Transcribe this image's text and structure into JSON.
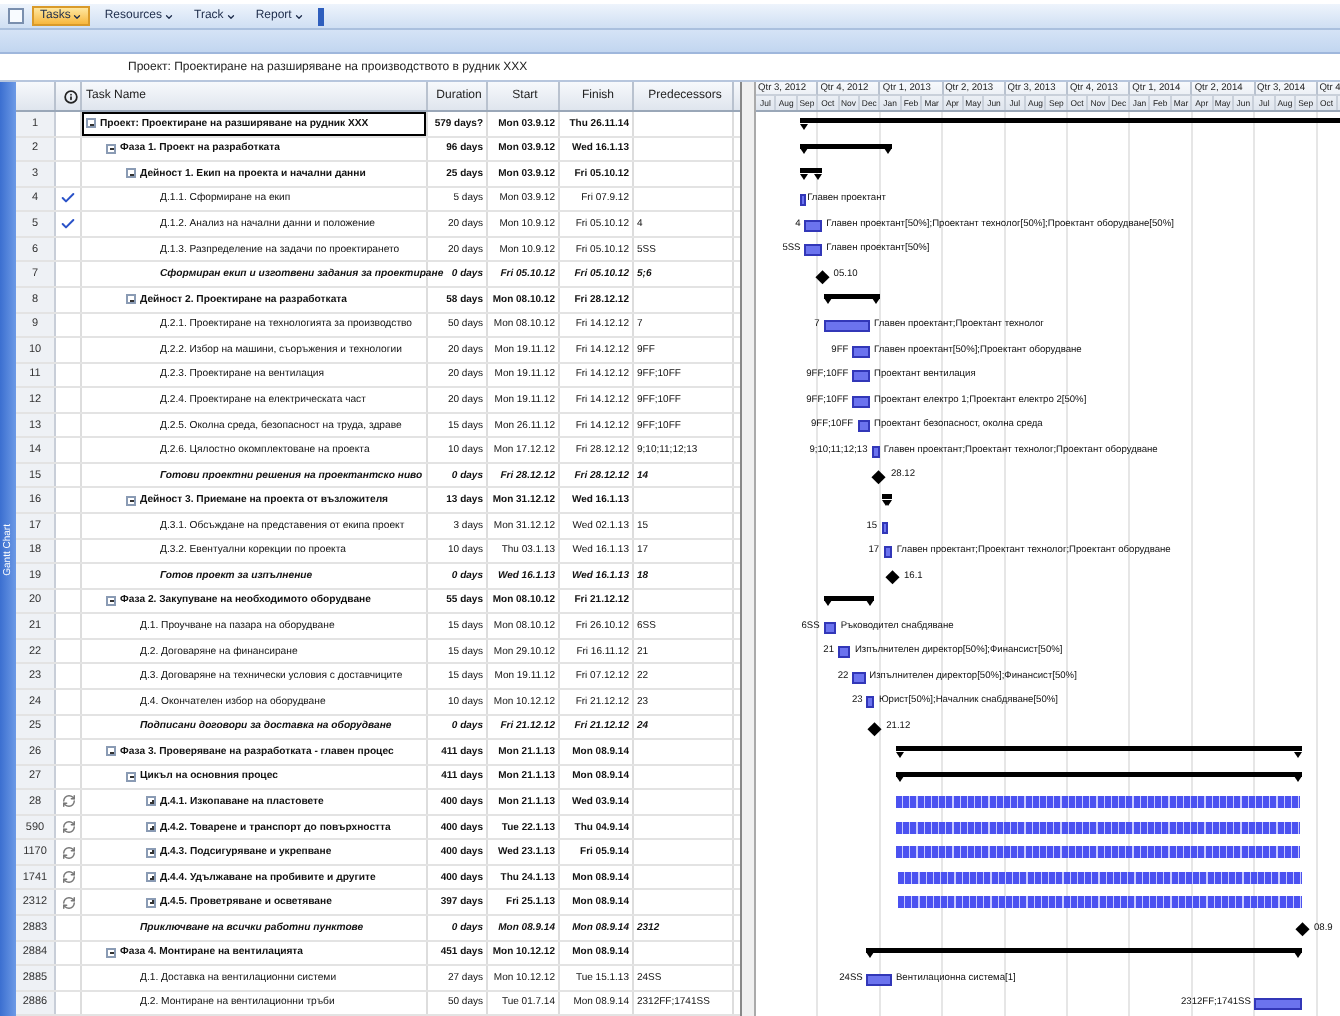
{
  "toolbar": {
    "items": [
      {
        "label": "Tasks",
        "selected": true
      },
      {
        "label": "Resources",
        "selected": false
      },
      {
        "label": "Track",
        "selected": false
      },
      {
        "label": "Report",
        "selected": false
      }
    ]
  },
  "project_title": "Проект: Проектиране на разширяване на производството в рудник XXX",
  "view_bar": "Gantt Chart",
  "columns": [
    "Task Name",
    "Duration",
    "Start",
    "Finish",
    "Predecessors"
  ],
  "timescale": {
    "quarters": [
      "Qtr 3, 2012",
      "Qtr 4, 2012",
      "Qtr 1, 2013",
      "Qtr 2, 2013",
      "Qtr 3, 2013",
      "Qtr 4, 2013",
      "Qtr 1, 2014",
      "Qtr 2, 2014",
      "Qtr 3, 2014",
      "Qtr 4"
    ],
    "months": [
      "Jul",
      "Aug",
      "Sep",
      "Oct",
      "Nov",
      "Dec",
      "Jan",
      "Feb",
      "Mar",
      "Apr",
      "May",
      "Jun",
      "Jul",
      "Aug",
      "Sep",
      "Oct",
      "Nov",
      "Dec",
      "Jan",
      "Feb",
      "Mar",
      "Apr",
      "May",
      "Jun",
      "Jul",
      "Aug",
      "Sep",
      "Oct"
    ]
  },
  "tasks": [
    {
      "id": "1",
      "kind": "summary",
      "name": "Проект: Проектиране на разширяване на рудник XXX",
      "duration": "579 days?",
      "start": "Mon 03.9.12",
      "finish": "Thu 26.11.14",
      "selected": true,
      "expanded": true,
      "children": [
        {
          "id": "2",
          "kind": "summary",
          "name": "Фаза 1. Проект на разработката",
          "duration": "96 days",
          "start": "Mon 03.9.12",
          "finish": "Wed 16.1.13",
          "selected": false,
          "expanded": true,
          "children": [
            {
              "id": "3",
              "kind": "summary",
              "name": "Дейност 1. Екип на проекта и начални данни",
              "duration": "25 days",
              "start": "Mon 03.9.12",
              "finish": "Fri 05.10.12",
              "selected": false,
              "expanded": true,
              "children": [
                {
                  "id": "4",
                  "kind": "task",
                  "complete": true,
                  "name": "Д.1.1. Сформиране на екип",
                  "duration": "5 days",
                  "start": "Mon 03.9.12",
                  "finish": "Fri 07.9.12",
                  "selected": false,
                  "bar_label": "Главен проектант"
                },
                {
                  "id": "5",
                  "kind": "task",
                  "complete": true,
                  "name": "Д.1.2. Анализ на начални данни и положение",
                  "duration": "20 days",
                  "start": "Mon 10.9.12",
                  "finish": "Fri 05.10.12",
                  "predecessors": "4",
                  "selected": false,
                  "bar_left_label": "4",
                  "bar_label": "Главен проектант[50%];Проектант технолог[50%];Проектант оборудване[50%]"
                },
                {
                  "id": "6",
                  "kind": "task",
                  "name": "Д.1.3. Разпределение на задачи по проектирането",
                  "duration": "20 days",
                  "start": "Mon 10.9.12",
                  "finish": "Fri 05.10.12",
                  "predecessors": "5SS",
                  "selected": false,
                  "bar_left_label": "5SS",
                  "bar_label": "Главен проектант[50%]"
                },
                {
                  "id": "7",
                  "kind": "milestone",
                  "name": "Сформиран екип и изготвени задания за проектиране",
                  "duration": "0 days",
                  "start": "Fri 05.10.12",
                  "finish": "Fri 05.10.12",
                  "predecessors": "5;6",
                  "selected": false,
                  "bar_label": "05.10"
                }
              ]
            },
            {
              "id": "8",
              "kind": "summary",
              "name": "Дейност 2. Проектиране на разработката",
              "duration": "58 days",
              "start": "Mon 08.10.12",
              "finish": "Fri 28.12.12",
              "selected": false,
              "expanded": true,
              "children": [
                {
                  "id": "9",
                  "kind": "task",
                  "name": "Д.2.1. Проектиране на технологията за производство",
                  "duration": "50 days",
                  "start": "Mon 08.10.12",
                  "finish": "Fri 14.12.12",
                  "predecessors": "7",
                  "selected": false,
                  "bar_left_label": "7",
                  "bar_label": "Главен проектант;Проектант технолог"
                },
                {
                  "id": "10",
                  "kind": "task",
                  "name": "Д.2.2. Избор на машини, съоръжения и технологии",
                  "duration": "20 days",
                  "start": "Mon 19.11.12",
                  "finish": "Fri 14.12.12",
                  "predecessors": "9FF",
                  "selected": false,
                  "bar_left_label": "9FF",
                  "bar_label": "Главен проектант[50%];Проектант оборудване"
                },
                {
                  "id": "11",
                  "kind": "task",
                  "name": "Д.2.3. Проектиране на вентилация",
                  "duration": "20 days",
                  "start": "Mon 19.11.12",
                  "finish": "Fri 14.12.12",
                  "predecessors": "9FF;10FF",
                  "selected": false,
                  "bar_left_label": "9FF;10FF",
                  "bar_label": "Проектант вентилация"
                },
                {
                  "id": "12",
                  "kind": "task",
                  "name": "Д.2.4. Проектиране на електрическата част",
                  "duration": "20 days",
                  "start": "Mon 19.11.12",
                  "finish": "Fri 14.12.12",
                  "predecessors": "9FF;10FF",
                  "selected": false,
                  "bar_left_label": "9FF;10FF",
                  "bar_label": "Проектант електро 1;Проектант електро 2[50%]"
                },
                {
                  "id": "13",
                  "kind": "task",
                  "name": "Д.2.5. Околна среда, безопасност на труда, здраве",
                  "duration": "15 days",
                  "start": "Mon 26.11.12",
                  "finish": "Fri 14.12.12",
                  "predecessors": "9FF;10FF",
                  "selected": false,
                  "bar_left_label": "9FF;10FF",
                  "bar_label": "Проектант безопасност, околна среда"
                },
                {
                  "id": "14",
                  "kind": "task",
                  "name": "Д.2.6. Цялостно окомплектоване на проекта",
                  "duration": "10 days",
                  "start": "Mon 17.12.12",
                  "finish": "Fri 28.12.12",
                  "predecessors": "9;10;11;12;13",
                  "selected": false,
                  "bar_left_label": "9;10;11;12;13",
                  "bar_label": "Главен проектант;Проектант технолог;Проектант оборудване"
                },
                {
                  "id": "15",
                  "kind": "milestone",
                  "name": "Готови проектни решения на проектантско ниво",
                  "duration": "0 days",
                  "start": "Fri 28.12.12",
                  "finish": "Fri 28.12.12",
                  "predecessors": "14",
                  "selected": false,
                  "bar_label": "28.12"
                }
              ]
            },
            {
              "id": "16",
              "kind": "summary",
              "name": "Дейност 3. Приемане на проекта от възложителя",
              "duration": "13 days",
              "start": "Mon 31.12.12",
              "finish": "Wed 16.1.13",
              "selected": false,
              "expanded": true,
              "children": [
                {
                  "id": "17",
                  "kind": "task",
                  "name": "Д.3.1. Обсъждане на представения от екипа проект",
                  "duration": "3 days",
                  "start": "Mon 31.12.12",
                  "finish": "Wed 02.1.13",
                  "predecessors": "15",
                  "selected": false,
                  "bar_left_label": "15"
                },
                {
                  "id": "18",
                  "kind": "task",
                  "name": "Д.3.2. Евентуални корекции по проекта",
                  "duration": "10 days",
                  "start": "Thu 03.1.13",
                  "finish": "Wed 16.1.13",
                  "predecessors": "17",
                  "selected": false,
                  "bar_left_label": "17",
                  "bar_label": "Главен проектант;Проектант технолог;Проектант оборудване"
                },
                {
                  "id": "19",
                  "kind": "milestone",
                  "name": "Готов проект за изпълнение",
                  "duration": "0 days",
                  "start": "Wed 16.1.13",
                  "finish": "Wed 16.1.13",
                  "predecessors": "18",
                  "selected": false,
                  "bar_label": "16.1"
                }
              ]
            }
          ]
        },
        {
          "id": "20",
          "kind": "summary",
          "name": "Фаза 2. Закупуване на необходимото оборудване",
          "duration": "55 days",
          "start": "Mon 08.10.12",
          "finish": "Fri 21.12.12",
          "selected": false,
          "expanded": true,
          "children": [
            {
              "id": "21",
              "kind": "task",
              "name": "Д.1. Проучване на пазара на оборудване",
              "duration": "15 days",
              "start": "Mon 08.10.12",
              "finish": "Fri 26.10.12",
              "predecessors": "6SS",
              "selected": false,
              "bar_left_label": "6SS",
              "bar_label": "Ръководител снабдяване"
            },
            {
              "id": "22",
              "kind": "task",
              "name": "Д.2. Договаряне на финансиране",
              "duration": "15 days",
              "start": "Mon 29.10.12",
              "finish": "Fri 16.11.12",
              "predecessors": "21",
              "selected": false,
              "bar_left_label": "21",
              "bar_label": "Изпълнителен директор[50%];Финансист[50%]"
            },
            {
              "id": "23",
              "kind": "task",
              "name": "Д.3. Договаряне на технически условия с доставчиците",
              "duration": "15 days",
              "start": "Mon 19.11.12",
              "finish": "Fri 07.12.12",
              "predecessors": "22",
              "selected": false,
              "bar_left_label": "22",
              "bar_label": "Изпълнителен директор[50%];Финансист[50%]"
            },
            {
              "id": "24",
              "kind": "task",
              "name": "Д.4. Окончателен избор на оборудване",
              "duration": "10 days",
              "start": "Mon 10.12.12",
              "finish": "Fri 21.12.12",
              "predecessors": "23",
              "selected": false,
              "bar_left_label": "23",
              "bar_label": "Юрист[50%];Началник снабдяване[50%]"
            },
            {
              "id": "25",
              "kind": "milestone",
              "name": "Подписани договори за доставка на оборудване",
              "duration": "0 days",
              "start": "Fri 21.12.12",
              "finish": "Fri 21.12.12",
              "predecessors": "24",
              "selected": false,
              "bar_label": "21.12"
            }
          ]
        },
        {
          "id": "26",
          "kind": "summary",
          "name": "Фаза 3. Проверяване на разработката - главен процес",
          "duration": "411 days",
          "start": "Mon 21.1.13",
          "finish": "Mon 08.9.14",
          "selected": false,
          "expanded": true,
          "children": [
            {
              "id": "27",
              "kind": "summary",
              "name": "Цикъл на основния процес",
              "duration": "411 days",
              "start": "Mon 21.1.13",
              "finish": "Mon 08.9.14",
              "selected": false,
              "expanded": true,
              "children": [
                {
                  "id": "28",
                  "kind": "recurring",
                  "name": "Д.4.1. Изкопаване на пластовете",
                  "duration": "400 days",
                  "start": "Mon 21.1.13",
                  "finish": "Wed 03.9.14",
                  "selected": false,
                  "expanded": false
                },
                {
                  "id": "590",
                  "kind": "recurring",
                  "name": "Д.4.2. Товарене и транспорт до повърхността",
                  "duration": "400 days",
                  "start": "Tue 22.1.13",
                  "finish": "Thu 04.9.14",
                  "selected": false,
                  "expanded": false
                },
                {
                  "id": "1170",
                  "kind": "recurring",
                  "name": "Д.4.3. Подсигуряване и укрепване",
                  "duration": "400 days",
                  "start": "Wed 23.1.13",
                  "finish": "Fri 05.9.14",
                  "selected": false,
                  "expanded": false
                },
                {
                  "id": "1741",
                  "kind": "recurring",
                  "name": "Д.4.4. Удължаване на пробивите и другите",
                  "duration": "400 days",
                  "start": "Thu 24.1.13",
                  "finish": "Mon 08.9.14",
                  "selected": false,
                  "expanded": false
                },
                {
                  "id": "2312",
                  "kind": "recurring",
                  "name": "Д.4.5. Проветряване и осветяване",
                  "duration": "397 days",
                  "start": "Fri 25.1.13",
                  "finish": "Mon 08.9.14",
                  "selected": false,
                  "expanded": false
                }
              ]
            },
            {
              "id": "2883",
              "kind": "milestone",
              "name": "Приключване на всички работни пунктове",
              "duration": "0 days",
              "start": "Mon 08.9.14",
              "finish": "Mon 08.9.14",
              "predecessors": "2312",
              "selected": false,
              "bar_label": "08.9"
            }
          ]
        },
        {
          "id": "2884",
          "kind": "summary",
          "name": "Фаза 4. Монтиране на вентилацията",
          "duration": "451 days",
          "start": "Mon 10.12.12",
          "finish": "Mon 08.9.14",
          "selected": false,
          "expanded": true,
          "children": [
            {
              "id": "2885",
              "kind": "task",
              "name": "Д.1. Доставка на вентилационни системи",
              "duration": "27 days",
              "start": "Mon 10.12.12",
              "finish": "Tue 15.1.13",
              "predecessors": "24SS",
              "selected": false,
              "bar_left_label": "24SS",
              "bar_label": "Вентилационна система[1]"
            },
            {
              "id": "2886",
              "kind": "task",
              "name": "Д.2. Монтиране на вентилационни тръби",
              "duration": "50 days",
              "start": "Tue 01.7.14",
              "finish": "Mon 08.9.14",
              "predecessors": "2312FF;1741SS",
              "selected": false,
              "bar_left_label": "2312FF;1741SS"
            }
          ]
        }
      ]
    }
  ]
}
